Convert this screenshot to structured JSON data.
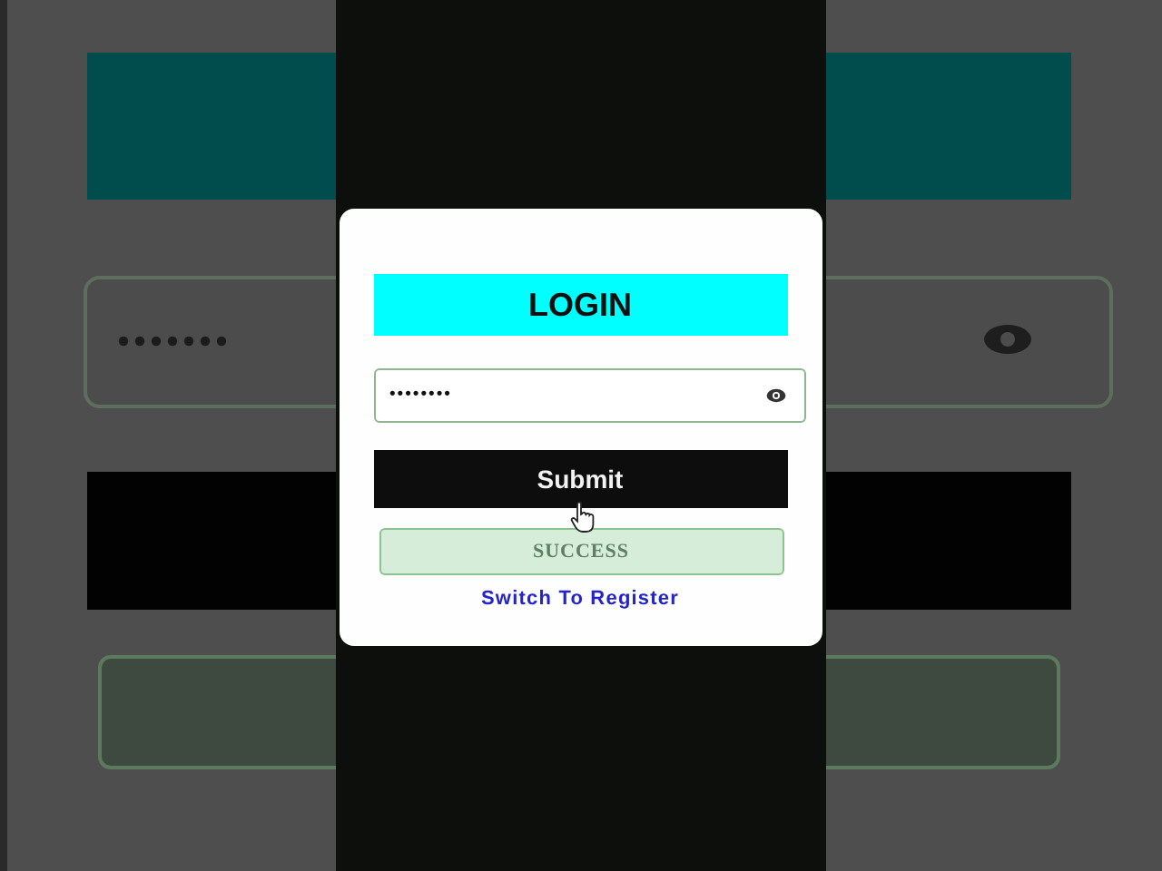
{
  "form": {
    "title": "LOGIN",
    "password": {
      "value": "••••••••"
    },
    "submit": "Submit",
    "message": {
      "text": "SUCCESS",
      "kind": "success"
    },
    "switch_link": "Switch To Register"
  }
}
